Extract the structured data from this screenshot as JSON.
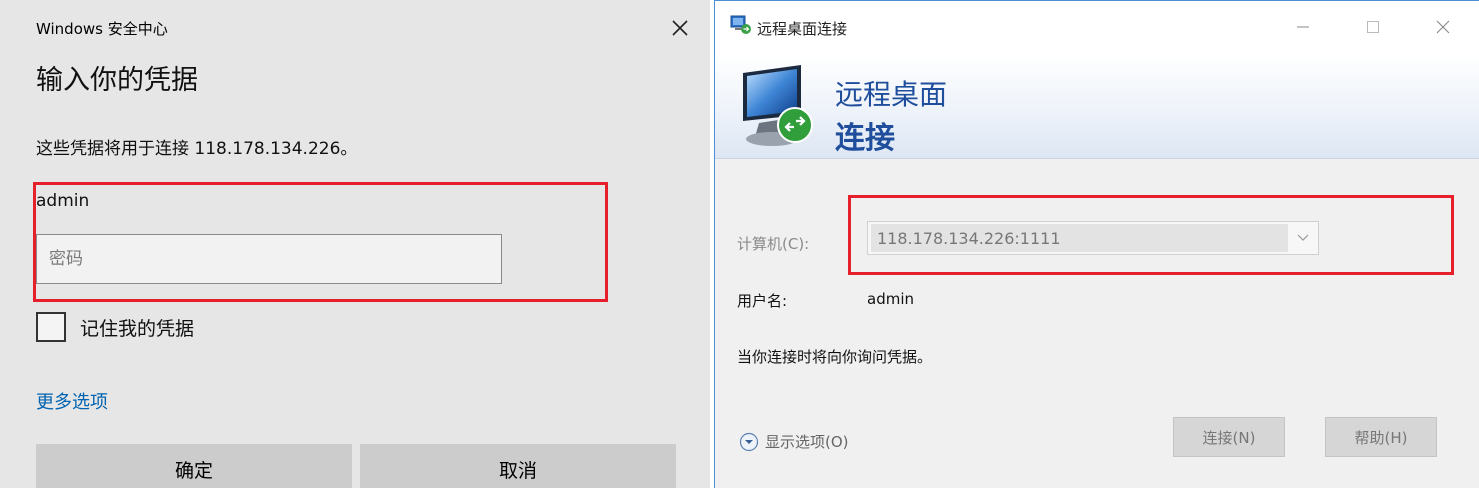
{
  "security_dialog": {
    "app_name": "Windows 安全中心",
    "heading": "输入你的凭据",
    "description": "这些凭据将用于连接 118.178.134.226。",
    "username": "admin",
    "password_placeholder": "密码",
    "remember_label": "记住我的凭据",
    "more_options": "更多选项",
    "ok_button": "确定",
    "cancel_button": "取消",
    "link_color": "#0063b1"
  },
  "rdc_window": {
    "title": "远程桌面连接",
    "banner_line1": "远程桌面",
    "banner_line2": "连接",
    "computer_label": "计算机(C):",
    "computer_value": "118.178.134.226:1111",
    "username_label": "用户名:",
    "username_value": "admin",
    "note": "当你连接时将向你询问凭据。",
    "show_options": "显示选项(O)",
    "connect_button": "连接(N)",
    "help_button": "帮助(H)",
    "accent_color": "#1f4e9c"
  },
  "highlight_color": "#e5202a",
  "icons": [
    "close-icon",
    "rdc-app-icon",
    "minimize-icon",
    "maximize-icon",
    "rdc-banner-icon",
    "chevron-down-icon",
    "expand-options-icon"
  ]
}
